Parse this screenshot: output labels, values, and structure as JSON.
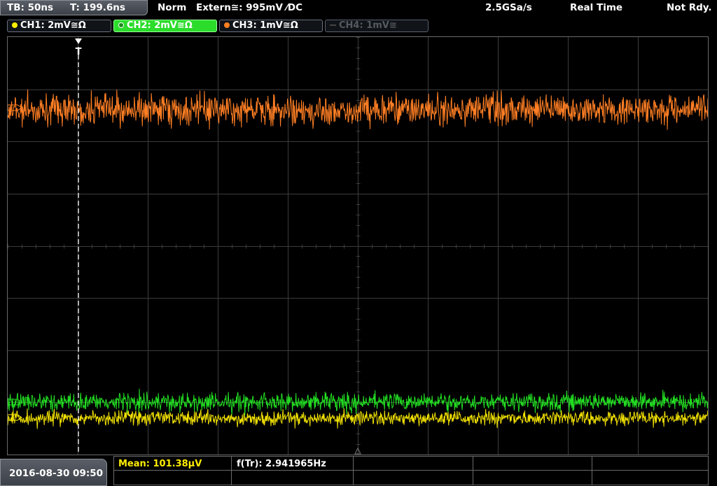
{
  "status": {
    "timebase": "TB: 50ns",
    "trigger_pos": "T: 199.6ns",
    "trigger_mode": "Norm",
    "trigger_source": "Extern≅: 995mV ⁄DC",
    "sample_rate": "2.5GSa/s",
    "acq_mode": "Real Time",
    "ready_state": "Not Rdy."
  },
  "channels": [
    {
      "label": "CH1: 2mV≅Ω",
      "color": "#ffee00",
      "state": "on"
    },
    {
      "label": "CH2: 2mV≅Ω",
      "color": "#22dd22",
      "state": "active"
    },
    {
      "label": "CH3: 1mV≅Ω",
      "color": "#ff8020",
      "state": "on"
    },
    {
      "label": "CH4: 1mV≅",
      "color": "#555a60",
      "state": "off"
    }
  ],
  "trigger_marker": "T",
  "datetime": "2016-08-30 09:50",
  "measurements": {
    "mean": "Mean: 101.38µV",
    "frequency": "f(Tr): 2.941965Hz"
  },
  "colors": {
    "ch1": "#f0e000",
    "ch2": "#22dd22",
    "ch3": "#ff7f24",
    "grid": "#3c3c3c",
    "meas_label": "#ffee00"
  }
}
